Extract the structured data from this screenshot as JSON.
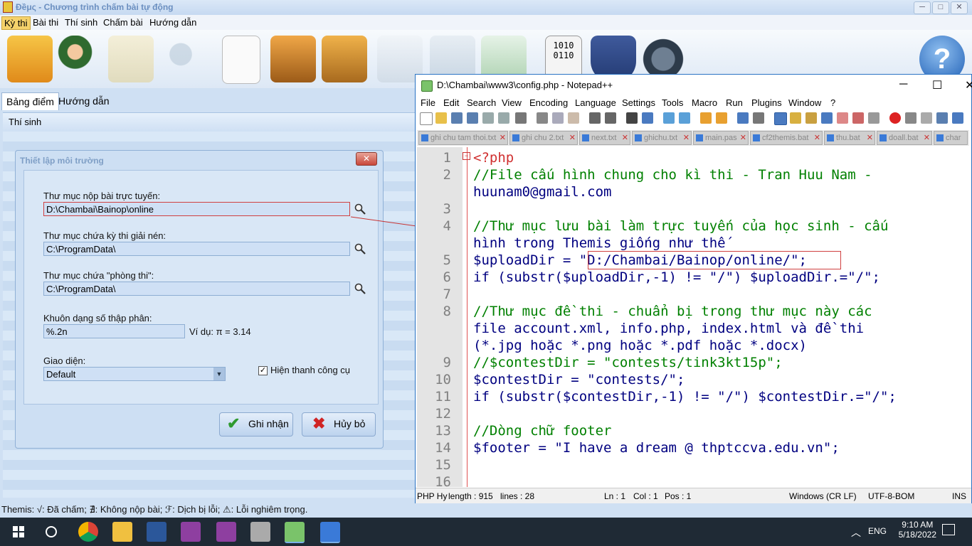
{
  "themis": {
    "title": "Đềμς - Chương trình chấm bài tự động",
    "menu": [
      "Kỳ thi",
      "Bài thi",
      "Thí sinh",
      "Chấm bài",
      "Hướng dẫn"
    ],
    "tabs": [
      "Bảng điểm",
      "Hướng dẫn"
    ],
    "section_header": "Thí sinh",
    "status": "Themis: √: Đã chấm; ∄: Không nộp bài; ℱ: Dịch bị lỗi; ⚠: Lỗi nghiêm trọng."
  },
  "dialog": {
    "title": "Thiết lập môi trường",
    "close": "✕",
    "online_label": "Thư mục nộp bài trực tuyến:",
    "online_value": "D:\\Chambai\\Bainop\\online",
    "contest_label": "Thư mục chứa kỳ thi giải nén:",
    "contest_value": "C:\\ProgramData\\",
    "room_label": "Thư mục chứa \"phòng thi\":",
    "room_value": "C:\\ProgramData\\",
    "decimal_label": "Khuôn dạng số thập phân:",
    "decimal_value": "%.2n",
    "decimal_example": "Ví dụ: π = 3.14",
    "ui_label": "Giao diện:",
    "ui_value": "Default",
    "toolbar_check": "Hiện thanh công cụ",
    "ok": "Ghi nhận",
    "cancel": "Hủy bỏ"
  },
  "npp": {
    "title": "D:\\Chambai\\www3\\config.php - Notepad++",
    "menu": [
      "File",
      "Edit",
      "Search",
      "View",
      "Encoding",
      "Language",
      "Settings",
      "Tools",
      "Macro",
      "Run",
      "Plugins",
      "Window",
      "?"
    ],
    "tabs": [
      "ghi chu tam thoi.txt",
      "ghi chu 2.txt",
      "next.txt",
      "ghichu.txt",
      "main.pas",
      "cf2themis.bat",
      "thu.bat",
      "doall.bat",
      "char"
    ],
    "lines": [
      {
        "n": "1",
        "text": "<?php"
      },
      {
        "n": "2",
        "text": "//File cấu hình chung cho kì thi - Tran Huu Nam -"
      },
      {
        "n": "",
        "text": "huunam0@gmail.com"
      },
      {
        "n": "3",
        "text": ""
      },
      {
        "n": "4",
        "text": "//Thư mục lưu bài làm trực tuyến của học sinh - cấu"
      },
      {
        "n": "",
        "text": "hình trong Themis giống như thế"
      },
      {
        "n": "5",
        "text": "$uploadDir = \"D:/Chambai/Bainop/online/\";"
      },
      {
        "n": "6",
        "text": "if (substr($uploadDir,-1) != \"/\") $uploadDir.=\"/\";"
      },
      {
        "n": "7",
        "text": ""
      },
      {
        "n": "8",
        "text": "//Thư mục đề thi - chuẩn bị trong thư mục này các"
      },
      {
        "n": "",
        "text": "file account.xml, info.php, index.html và đề thi"
      },
      {
        "n": "",
        "text": "(*.jpg hoặc *.png hoặc *.pdf hoặc *.docx)"
      },
      {
        "n": "9",
        "text": "//$contestDir = \"contests/tink3kt15p\";"
      },
      {
        "n": "10",
        "text": "$contestDir = \"contests/\";"
      },
      {
        "n": "11",
        "text": "if (substr($contestDir,-1) != \"/\") $contestDir.=\"/\";"
      },
      {
        "n": "12",
        "text": ""
      },
      {
        "n": "13",
        "text": "//Dòng chữ footer"
      },
      {
        "n": "14",
        "text": "$footer = \"I have a dream @ thptccva.edu.vn\";"
      },
      {
        "n": "15",
        "text": ""
      },
      {
        "n": "16",
        "text": ""
      }
    ],
    "status": {
      "type": "PHP Hy",
      "length": "length : 915",
      "lines": "lines : 28",
      "ln": "Ln : 1",
      "col": "Col : 1",
      "pos": "Pos : 1",
      "eol": "Windows (CR LF)",
      "enc": "UTF-8-BOM",
      "ins": "INS"
    }
  },
  "taskbar": {
    "time": "9:10 AM",
    "date": "5/18/2022",
    "lang": "ENG"
  }
}
